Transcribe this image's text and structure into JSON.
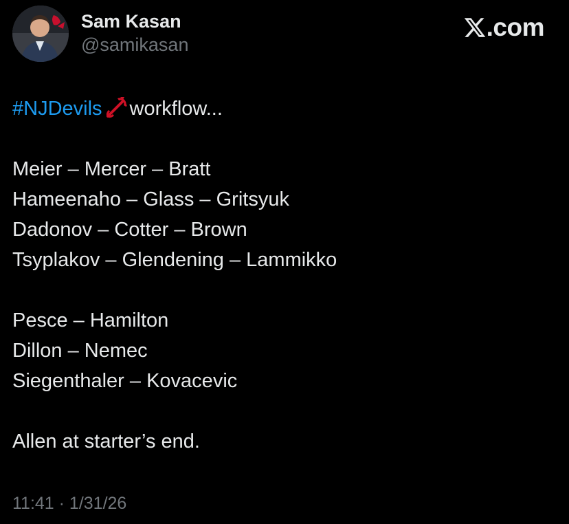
{
  "author": {
    "display_name": "Sam Kasan",
    "handle": "@samikasan",
    "avatar_icon": "profile-photo"
  },
  "brand": {
    "logo_icon": "x-logo-icon",
    "text": ".com"
  },
  "tweet": {
    "hashtag": "#NJDevils",
    "emoji_icon": "devils-pitchfork-emoji",
    "intro_text": "workflow...",
    "forward_lines": [
      "Meier – Mercer – Bratt",
      "Hameenaho – Glass – Gritsyuk",
      "Dadonov – Cotter – Brown",
      "Tsyplakov – Glendening – Lammikko"
    ],
    "defense_pairs": [
      "Pesce – Hamilton",
      "Dillon – Nemec",
      "Siegenthaler – Kovacevic"
    ],
    "goalie_note": "Allen at starter’s end."
  },
  "meta": {
    "timestamp": "11:41 · 1/31/26"
  },
  "colors": {
    "background": "#000000",
    "text": "#e7e9ea",
    "muted": "#71767b",
    "link": "#1d9bf0",
    "emoji_red": "#ce1126"
  }
}
